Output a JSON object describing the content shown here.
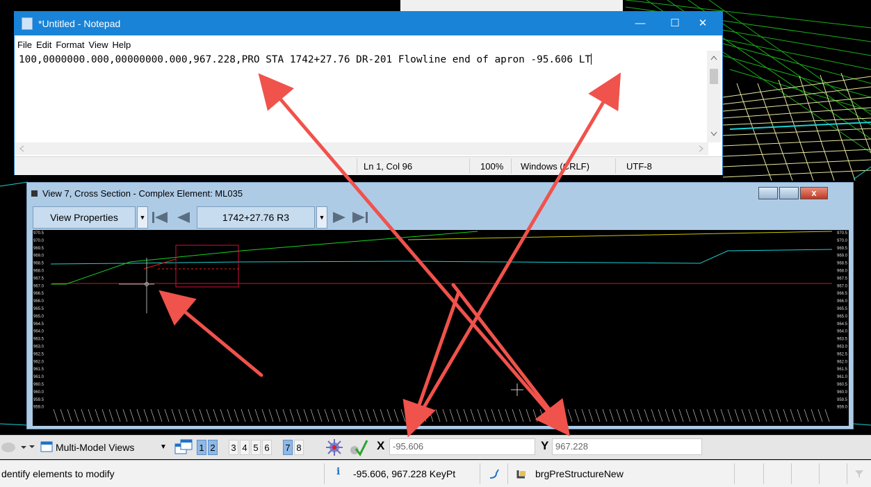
{
  "notepad": {
    "title": "*Untitled - Notepad",
    "menu": [
      "File",
      "Edit",
      "Format",
      "View",
      "Help"
    ],
    "text": "100,0000000.000,00000000.000,967.228,PRO STA 1742+27.76 DR-201 Flowline end of apron -95.606 LT",
    "status": {
      "position": "Ln 1, Col 96",
      "zoom": "100%",
      "line_ending": "Windows (CRLF)",
      "encoding": "UTF-8"
    },
    "controls": {
      "minimize": "—",
      "maximize": "☐",
      "close": "✕"
    }
  },
  "view7": {
    "title": "View 7, Cross Section - Complex Element: ML035",
    "view_properties": "View Properties",
    "station": "1742+27.76 R3",
    "close_glyph": "x",
    "y_axis_labels": [
      "970.5",
      "970.0",
      "969.5",
      "969.0",
      "968.5",
      "968.0",
      "967.5",
      "967.0",
      "966.5",
      "966.0",
      "965.5",
      "965.0",
      "964.5",
      "964.0",
      "963.5",
      "963.0",
      "962.5",
      "962.0",
      "961.5",
      "961.0",
      "960.5",
      "960.0",
      "959.5",
      "959.0"
    ]
  },
  "toolbar": {
    "multi_model_label": "Multi-Model Views",
    "view_numbers": [
      "1",
      "2",
      "3",
      "4",
      "5",
      "6",
      "7",
      "8"
    ],
    "active_views": [
      "1",
      "2",
      "7"
    ],
    "x_label": "X",
    "x_value": "-95.606",
    "y_label": "Y",
    "y_value": "967.228"
  },
  "statusbar": {
    "prompt": "dentify elements to modify",
    "keypoint": "-95.606, 967.228 KeyPt",
    "level": "brgPreStructureNew"
  },
  "colors": {
    "notepad_title": "#1883d7",
    "view_frame": "#aecbe6",
    "arrow": "#f0524c",
    "active_view": "#8fb8e6"
  },
  "icons": [
    "notepad-icon",
    "first-icon",
    "prev-icon",
    "next-icon",
    "last-icon",
    "snap-icon",
    "accudraw-icon",
    "info-icon",
    "line-tool-icon",
    "level-icon"
  ]
}
